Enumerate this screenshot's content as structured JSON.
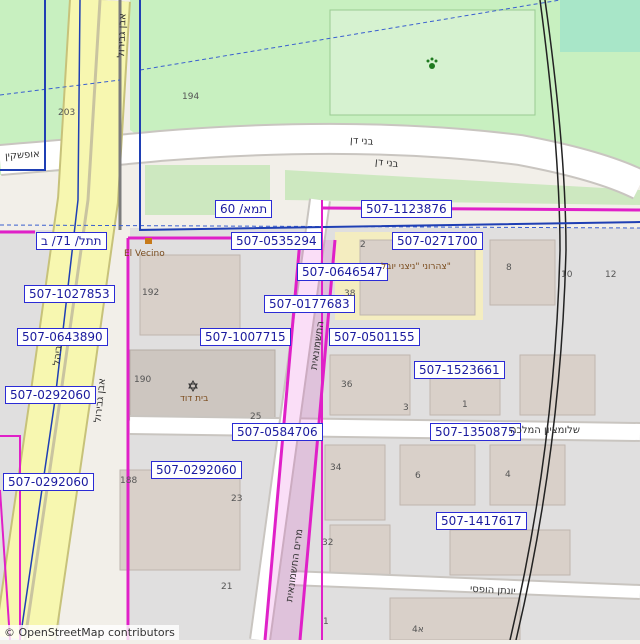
{
  "plan_labels": [
    {
      "text": "507-1123876"
    },
    {
      "text": "507-0271700"
    },
    {
      "text": "507-0535294"
    },
    {
      "text": "507-0646547"
    },
    {
      "text": "507-0177683"
    },
    {
      "text": "507-1007715"
    },
    {
      "text": "507-0501155"
    },
    {
      "text": "507-1523661"
    },
    {
      "text": "507-1027853"
    },
    {
      "text": "507-0643890"
    },
    {
      "text": "507-0292060"
    },
    {
      "text": "507-0584706"
    },
    {
      "text": "507-1350875"
    },
    {
      "text": "507-0292060"
    },
    {
      "text": "507-0292060"
    },
    {
      "text": "507-1417617"
    },
    {
      "text": "תמא/ 60"
    },
    {
      "text": "תתל/ 71/ ב"
    }
  ],
  "streets": [
    {
      "text": "בני דן"
    },
    {
      "text": "בני דן"
    },
    {
      "text": "אופשקין"
    },
    {
      "text": "אבן גבירול"
    },
    {
      "text": "ביהל"
    },
    {
      "text": "שלומציון המלכה"
    },
    {
      "text": "יונתן הופסי"
    },
    {
      "text": "מרים החשמונאית"
    },
    {
      "text": "החשמונאית"
    },
    {
      "text": "אבן גבירול"
    }
  ],
  "building_numbers": [
    "194",
    "203",
    "192",
    "190",
    "25",
    "188",
    "23",
    "21",
    "2",
    "8",
    "10",
    "12",
    "38",
    "36",
    "3",
    "1",
    "34",
    "6",
    "4",
    "32",
    "4א",
    "1"
  ],
  "pois": [
    {
      "text": "El Vecino"
    },
    {
      "text": "בית דוד"
    },
    {
      "text": "צהרוני \"ניצני יובל\""
    }
  ],
  "attribution": "© OpenStreetMap contributors",
  "colors": {
    "plan_boundary": "#e020c8",
    "label_border": "#2b2bd6",
    "park": "#c8f0c0",
    "road": "#ffffff",
    "trunk_road": "#f7f7b0",
    "building": "#d9d0c9"
  }
}
